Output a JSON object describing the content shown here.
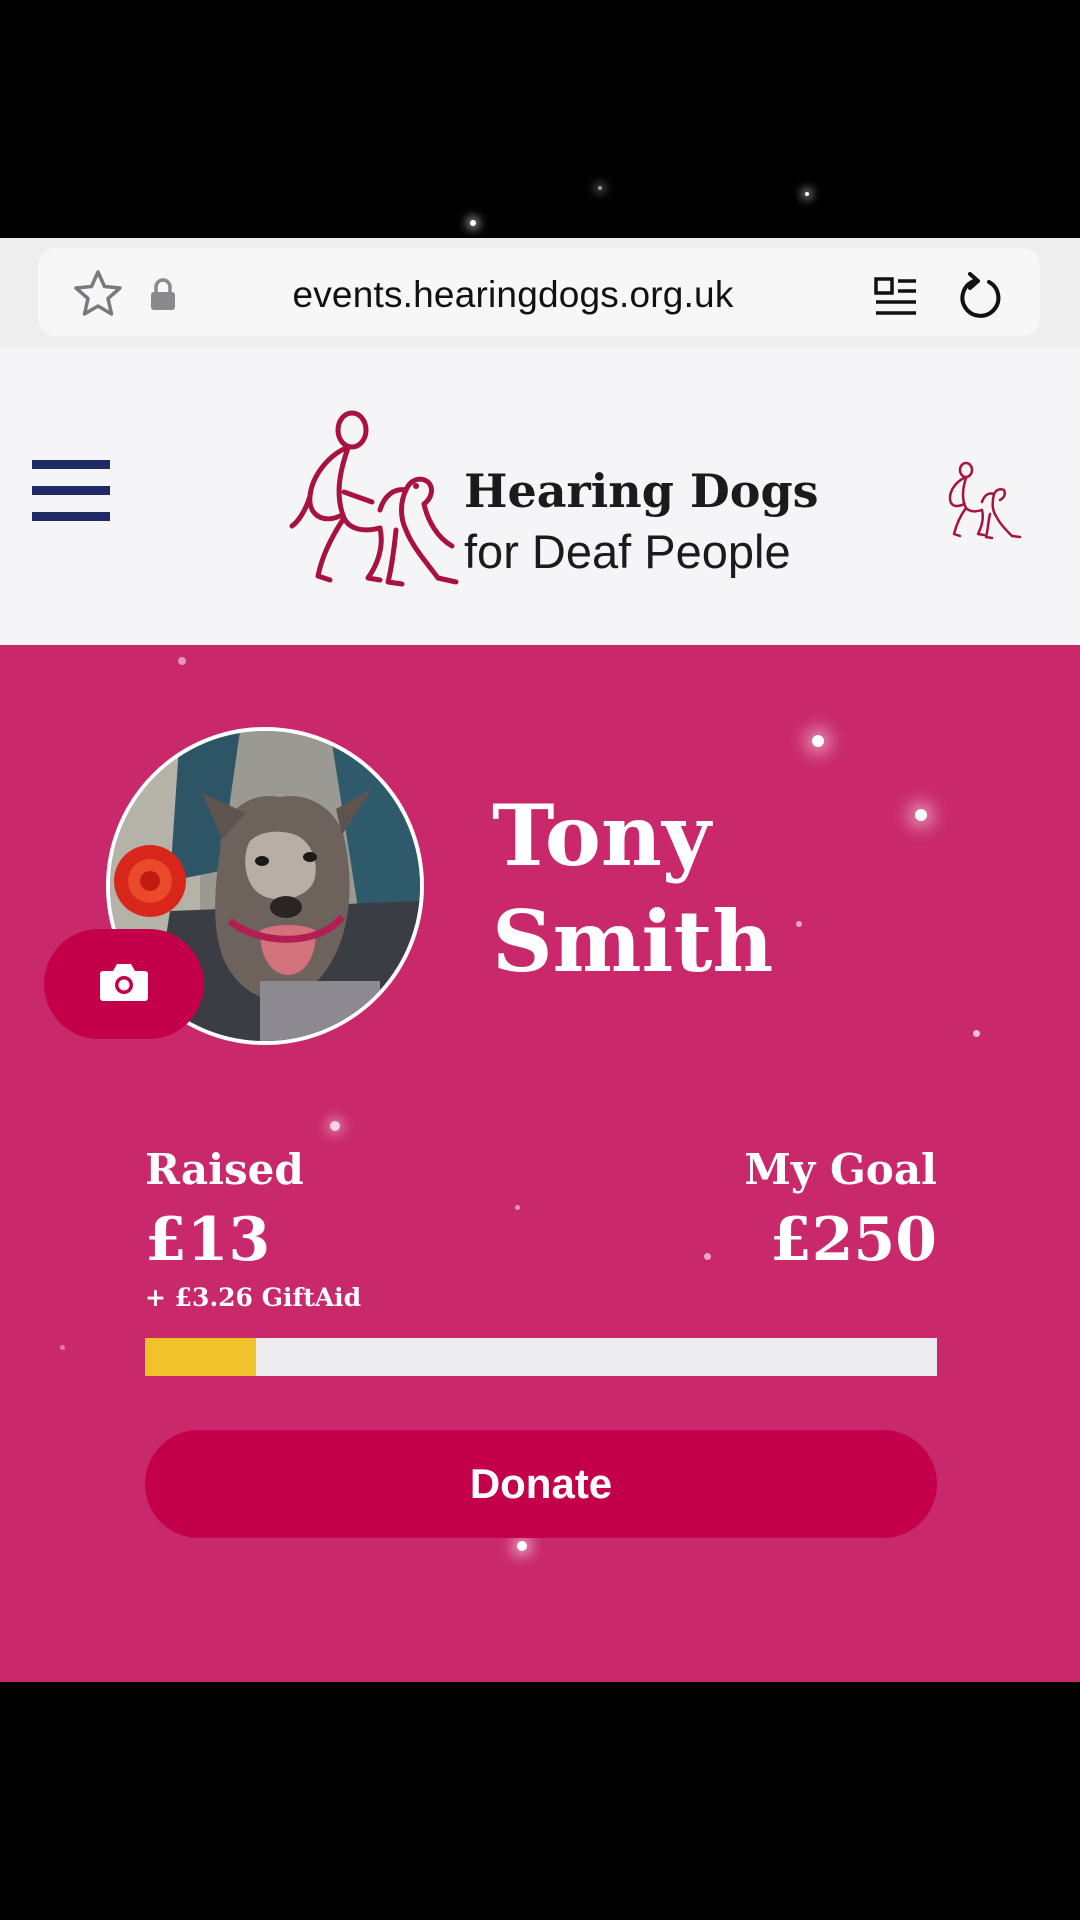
{
  "browser": {
    "url": "events.hearingdogs.org.uk",
    "icons": {
      "bookmark": "star-icon",
      "secure": "lock-icon",
      "reader": "reader-mode-icon",
      "reload": "reload-icon"
    }
  },
  "header": {
    "menu_icon": "hamburger-menu-icon",
    "logo_line1": "Hearing Dogs",
    "logo_line2": "for Deaf People",
    "account_icon": "person-with-dog-icon"
  },
  "profile": {
    "name": "Tony Smith",
    "photo": "dog-in-pram-photo",
    "camera_icon": "camera-icon"
  },
  "fundraising": {
    "raised_label": "Raised",
    "raised_amount": "£13",
    "giftaid": "+ £3.26 GiftAid",
    "goal_label": "My Goal",
    "goal_amount": "£250",
    "progress_fraction": 0.14,
    "donate_label": "Donate"
  },
  "colors": {
    "hero_background": "#c9286b",
    "button": "#c5004a",
    "progress_fill": "#f0c32a",
    "progress_track": "#ececef",
    "menu_icon": "#1f2a64",
    "logo_mark": "#a8123e"
  }
}
